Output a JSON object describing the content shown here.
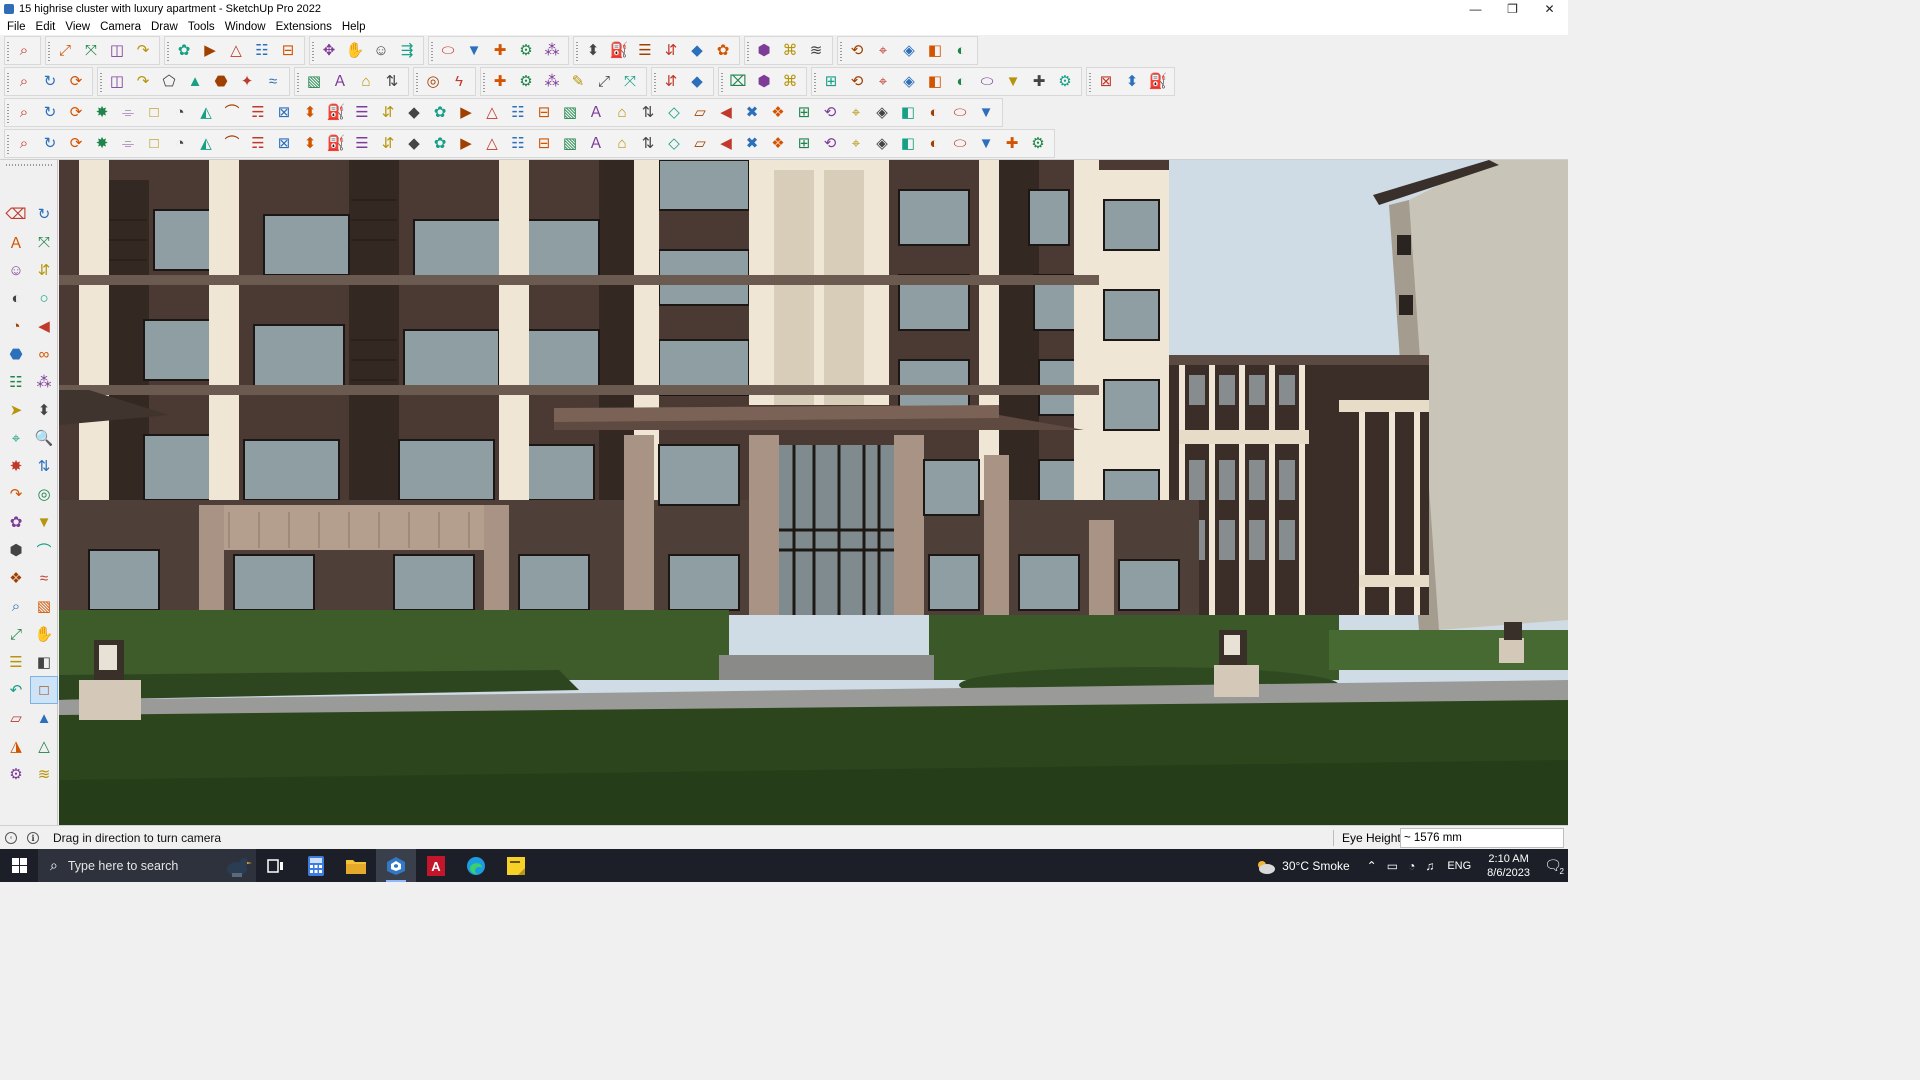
{
  "window": {
    "title": "15 highrise cluster with luxury apartment - SketchUp Pro 2022",
    "controls": {
      "minimize": "—",
      "restore": "❐",
      "close": "✕"
    }
  },
  "menu": {
    "items": [
      "File",
      "Edit",
      "View",
      "Camera",
      "Draw",
      "Tools",
      "Window",
      "Extensions",
      "Help"
    ]
  },
  "toolbars": {
    "row1_icons": [
      "search-icon",
      "select-icon",
      "eraser-icon",
      "pencil-icon",
      "lasso-icon",
      "rectangle-icon",
      "push-pull-icon",
      "follow-me-icon",
      "move-icon",
      "rotate-icon",
      "scale-icon",
      "tape-measure-icon",
      "text-icon",
      "paint-bucket-icon",
      "orbit-icon",
      "pan-icon",
      "zoom-icon",
      "zoom-extents-icon",
      "component-icon",
      "warehouse-icon",
      "layers-icon",
      "extension-icon",
      "user-icon",
      "axes-icon",
      "section-plane-icon",
      "section-fill-icon",
      "up-arrow-icon",
      "down-arrow-icon",
      "tag-icon",
      "share-icon",
      "undo-icon",
      "redo-icon",
      "style-icon"
    ],
    "row2_icons": [
      "iso-view-icon",
      "top-view-icon",
      "front-view-icon",
      "shaded-icon",
      "intersect-icon",
      "union-icon",
      "subtract-icon",
      "trim-icon",
      "split-icon",
      "outer-shell-icon",
      "arc-icon",
      "section-cut-icon",
      "section-display-icon",
      "section-fill-toggle-icon",
      "sandbox-icon",
      "smoove-icon",
      "house-icon",
      "house-front-icon",
      "house-outline-icon",
      "house-wide-icon",
      "formula-icon",
      "tag-shape-icon",
      "ruler-icon",
      "circle-a-icon",
      "circle-b-icon",
      "polygon-icon",
      "ellipse-icon",
      "parallelogram-icon",
      "arc-b-icon",
      "flower-icon",
      "pie-icon",
      "lightning-icon",
      "eraser-b-icon",
      "shape-a-icon",
      "shape-b-icon",
      "shape-c-icon",
      "shape-d-icon",
      "shape-e-icon",
      "shape-f-icon",
      "shape-g-icon"
    ],
    "row3_icons": [
      "plane-icon",
      "plane-b-icon",
      "plane-c-icon",
      "plane-d-icon",
      "plane-e-icon",
      "plane-f-icon",
      "loop-icon",
      "square-icon",
      "box-icon",
      "frame-icon",
      "block-icon",
      "mirror-icon",
      "dots-icon",
      "curve-icon",
      "cross-icon",
      "plus-icon",
      "x-icon",
      "cone-icon",
      "drop-icon",
      "triangle-icon",
      "hook-icon",
      "knot-icon",
      "spiral-icon",
      "compass-icon",
      "cup-icon",
      "bend-icon",
      "array-icon",
      "cube-tool-icon",
      "cube-tool-b-icon",
      "cube-tool-c-icon",
      "gem-icon",
      "grid-icon",
      "grid-b-icon",
      "grid-c-icon",
      "grid-d-icon",
      "scissors-icon",
      "curve-b-icon",
      "grid-e-icon"
    ],
    "row4_icons": [
      "path-icon",
      "curve-path-icon",
      "pen-tool-icon",
      "cut-icon",
      "gear-icon",
      "bulb-icon",
      "spring-icon",
      "sphere-icon",
      "helix-icon",
      "rod-icon",
      "ladder-icon",
      "stair-icon",
      "line-icon",
      "slope-icon",
      "barrel-icon",
      "prism-icon",
      "column-icon",
      "column-b-icon",
      "mesh-icon",
      "leaf-icon",
      "spear-icon",
      "stack-icon",
      "blade-icon",
      "fan-icon",
      "fan-b-icon",
      "fan-c-icon",
      "fan-d-icon",
      "block-b-icon",
      "stripe-icon",
      "stripe-b-icon",
      "stripe-c-icon",
      "stripe-d-icon",
      "stripe-e-icon",
      "stripe-f-icon",
      "stripe-g-icon",
      "wheel-icon",
      "wheel-b-icon",
      "wedge-icon",
      "comb-icon",
      "diamond-icon"
    ]
  },
  "sidebar": {
    "tools": [
      "select-icon",
      "orbit-icon",
      "paint-bucket-icon",
      "eraser-icon",
      "component-icon",
      "tape-measure-icon",
      "line-icon",
      "freehand-icon",
      "rectangle-icon",
      "rotated-rectangle-icon",
      "circle-icon",
      "polygon-icon",
      "arc-icon",
      "pie-icon",
      "arc-b-icon",
      "arc-c-icon",
      "move-icon",
      "push-pull-icon",
      "rotate-icon",
      "follow-me-icon",
      "scale-icon",
      "offset-icon",
      "tape-icon",
      "dimension-icon",
      "protractor-icon",
      "text-icon",
      "axes-icon",
      "3d-text-icon",
      "orbit-b-icon",
      "pan-icon",
      "zoom-icon",
      "zoom-window-icon",
      "zoom-extents-icon",
      "previous-view-icon",
      "walk-icon",
      "look-around-icon",
      "position-camera-icon",
      "section-plane-icon",
      "warehouse-icon",
      "extension-warehouse-icon",
      "layers-b-icon",
      "tags-icon"
    ]
  },
  "status": {
    "hint": "Drag in direction to turn camera",
    "measure_label": "Eye Height",
    "measure_value": "~ 1576 mm"
  },
  "taskbar": {
    "search_placeholder": "Type here to search",
    "weather": "30°C  Smoke",
    "language": "ENG",
    "time": "2:10 AM",
    "date": "8/6/2023",
    "notification_count": "2"
  },
  "colors": {
    "sky": "#cfdce5",
    "grass": "#2f4a1f",
    "wall_dark": "#4a3a33",
    "wall_light": "#f1e8d8",
    "glass": "#8f9ea3",
    "taskbar": "#1c1f28"
  }
}
